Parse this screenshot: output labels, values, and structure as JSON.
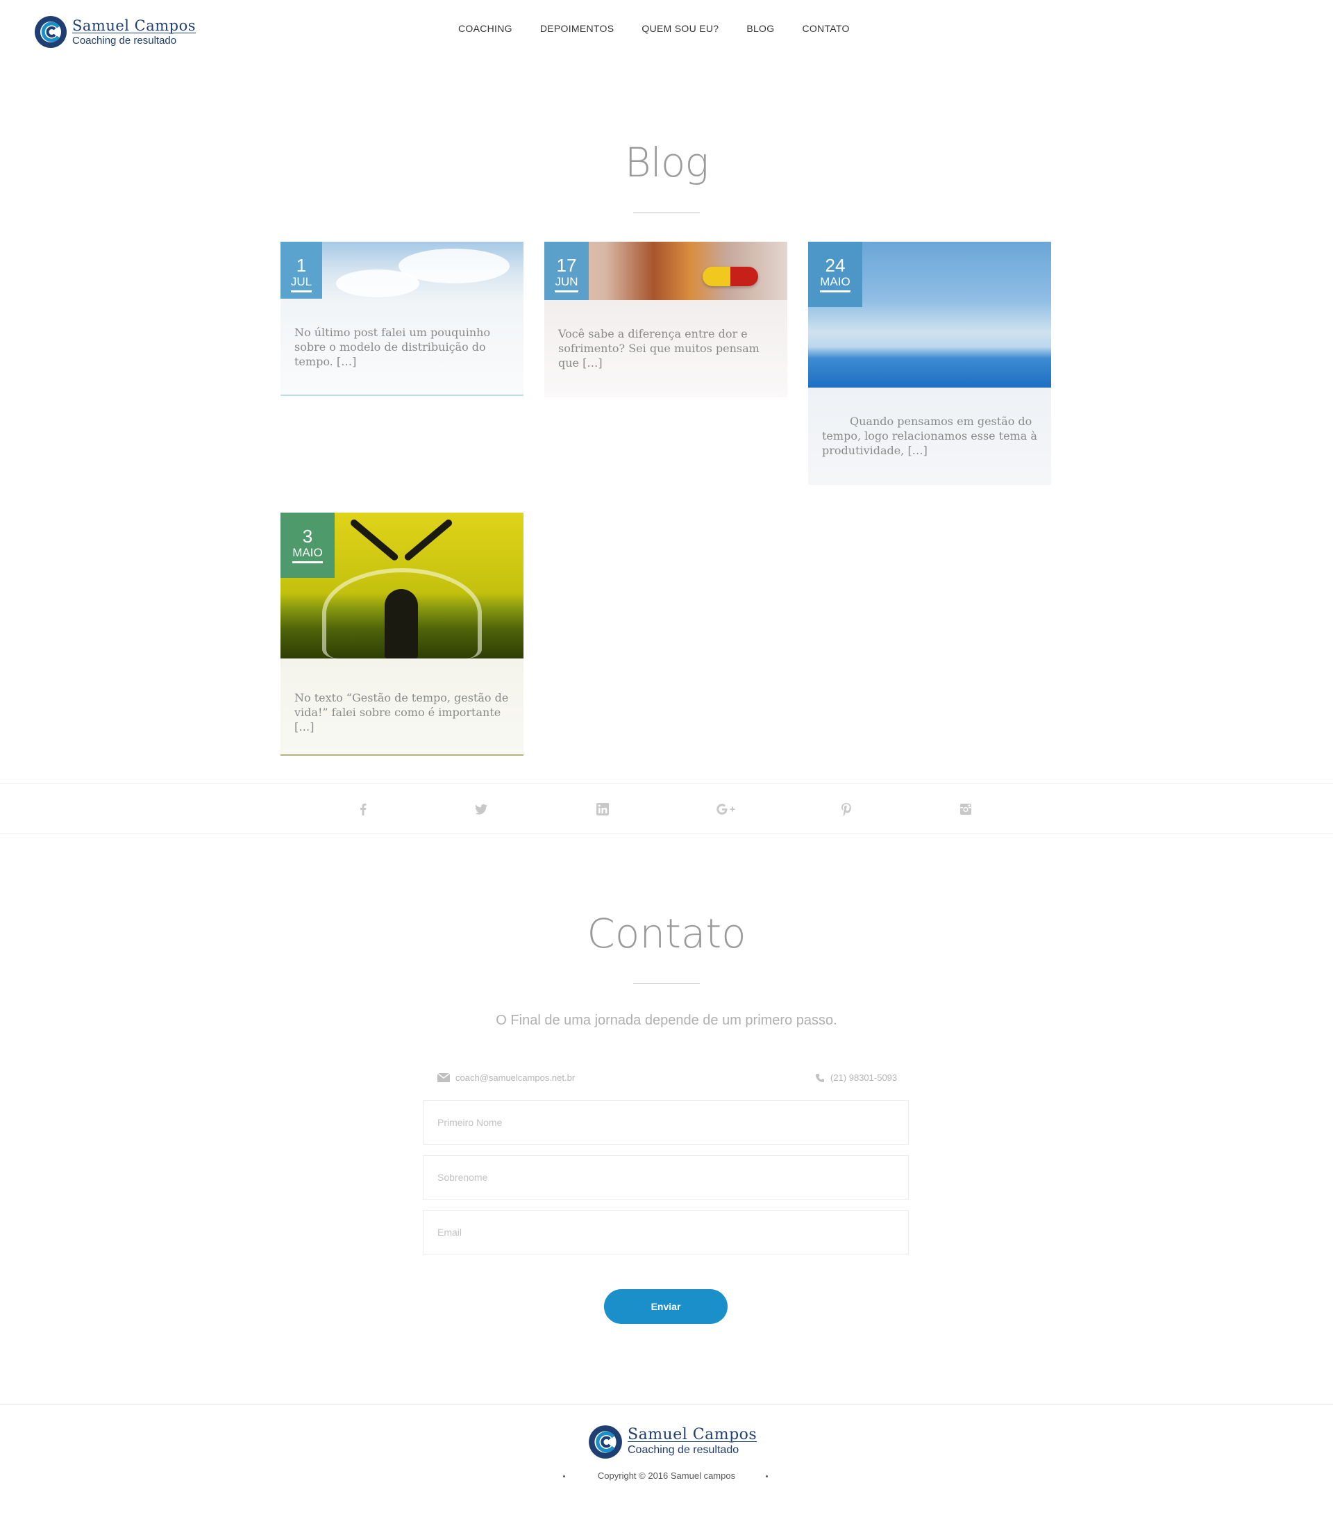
{
  "brand": {
    "name": "Samuel Campos",
    "tagline": "Coaching de resultado"
  },
  "nav": {
    "items": [
      "COACHING",
      "DEPOIMENTOS",
      "QUEM SOU EU?",
      "BLOG",
      "CONTATO"
    ]
  },
  "blog": {
    "title": "Blog",
    "posts": [
      {
        "day": "1",
        "month": "JUL",
        "excerpt": "No último post falei um pouquinho sobre o modelo de distribuição do tempo. […]"
      },
      {
        "day": "17",
        "month": "JUN",
        "excerpt": "Você sabe a diferença entre dor e sofrimento? Sei que muitos pensam que […]"
      },
      {
        "day": "24",
        "month": "MAIO",
        "excerpt": "Quando pensamos em gestão do tempo, logo relacionamos esse tema à produtividade, […]"
      },
      {
        "day": "3",
        "month": "MAIO",
        "excerpt": "No texto “Gestão de tempo, gestão de vida!” falei sobre como é importante […]"
      }
    ]
  },
  "social": {
    "icons": [
      "facebook-icon",
      "twitter-icon",
      "linkedin-icon",
      "google-plus-icon",
      "pinterest-icon",
      "instagram-icon"
    ]
  },
  "contact": {
    "title": "Contato",
    "subtitle": "O Final de uma jornada depende de um primero passo.",
    "email": "coach@samuelcampos.net.br",
    "phone": "(21) 98301-5093",
    "first_name_placeholder": "Primeiro Nome",
    "last_name_placeholder": "Sobrenome",
    "email_placeholder": "Email",
    "submit_label": "Enviar"
  },
  "footer": {
    "copyright": "Copyright © 2016 Samuel campos"
  },
  "colors": {
    "brand_blue": "#1f3e72",
    "accent_blue": "#1a8fc9"
  }
}
